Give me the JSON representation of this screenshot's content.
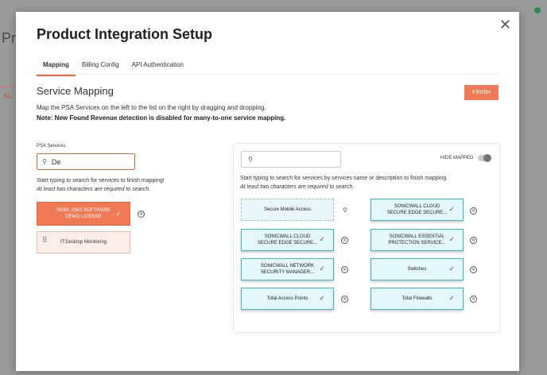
{
  "background": {
    "title": "Pr",
    "tab_label": "AL"
  },
  "modal": {
    "title": "Product Integration Setup",
    "close_label": "✕",
    "tabs": [
      {
        "label": "Mapping",
        "active": true
      },
      {
        "label": "Billing Config",
        "active": false
      },
      {
        "label": "API Authentication",
        "active": false
      }
    ],
    "section_title": "Service Mapping",
    "finish_label": "FINISH",
    "description": "Map the PSA Services on the left to the list on the right by dragging and dropping.",
    "note": "Note: New Found Revenue detection is disabled for many-to-one service mapping."
  },
  "psa": {
    "label": "PSA Services",
    "search_value": "De",
    "hint": "Start typing to search for services to finish mapping!",
    "hint_min": "At least two characters are required to search.",
    "cards": [
      {
        "line1": "SNWL GMS SOFTWARE",
        "line2": "DEMO LICENSE",
        "mapped": true
      },
      {
        "line1": "IT:Desktop Monitoring",
        "line2": "",
        "mapped": false
      }
    ]
  },
  "services": {
    "search_value": "",
    "hide_mapped_label": "HIDE MAPPED",
    "hide_mapped_on": false,
    "hint": "Start typing to search for services by services name or description to finish mapping.",
    "hint_min": "At least two characters are required to search.",
    "items": [
      {
        "line1": "Secure Mobile Access",
        "line2": "",
        "mapped": false
      },
      {
        "line1": "SONICWALL CLOUD",
        "line2": "SECURE EDGE SECURE...",
        "mapped": true
      },
      {
        "line1": "SONICWALL CLOUD",
        "line2": "SECURE EDGE SECURE...",
        "mapped": true
      },
      {
        "line1": "SONICWALL ESSENTIAL",
        "line2": "PROTECTION SERVICE...",
        "mapped": true
      },
      {
        "line1": "SONICWALL NETWORK",
        "line2": "SECURITY MANAGER...",
        "mapped": true
      },
      {
        "line1": "Switches",
        "line2": "",
        "mapped": true
      },
      {
        "line1": "Total Access Points",
        "line2": "",
        "mapped": true
      },
      {
        "line1": "Total Firewalls",
        "line2": "",
        "mapped": true
      }
    ]
  },
  "colors": {
    "accent": "#f07a56",
    "mapped_border": "#3fb6c4",
    "mapped_bg": "#e4f7f9"
  }
}
